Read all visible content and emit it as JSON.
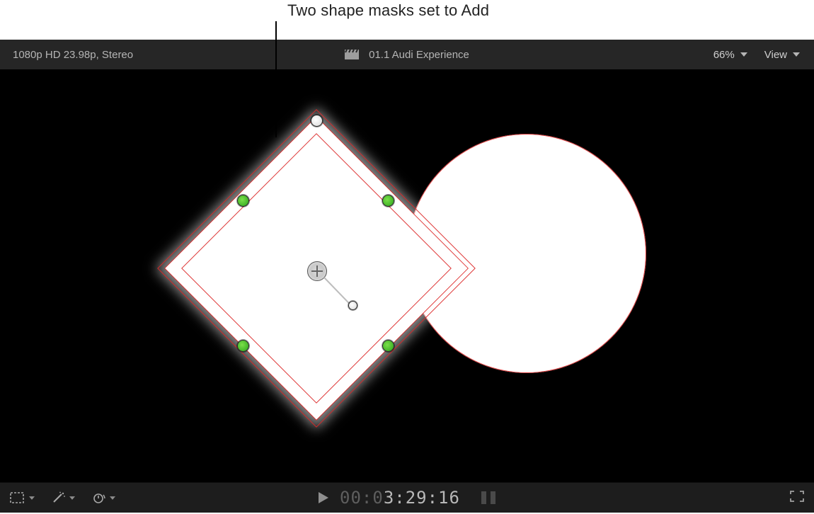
{
  "annotation": {
    "label": "Two shape masks set to Add"
  },
  "header": {
    "format": "1080p HD 23.98p, Stereo",
    "clip_name": "01.1 Audi Experience",
    "zoom_label": "66%",
    "view_label": "View"
  },
  "footer": {
    "timecode_dim": "00:0",
    "timecode_bright": "3:29:16"
  },
  "icons": {
    "clapper": "clapperboard-icon",
    "chevron": "chevron-down-icon",
    "crop": "crop-transform-icon",
    "wand": "enhance-wand-icon",
    "retime": "retime-speed-icon",
    "play": "play-icon",
    "fullscreen": "fullscreen-icon"
  },
  "viewer": {
    "masks": [
      {
        "type": "rectangle_rotated_45",
        "mode": "Add",
        "selected": true
      },
      {
        "type": "circle",
        "mode": "Add",
        "selected": false
      }
    ]
  }
}
